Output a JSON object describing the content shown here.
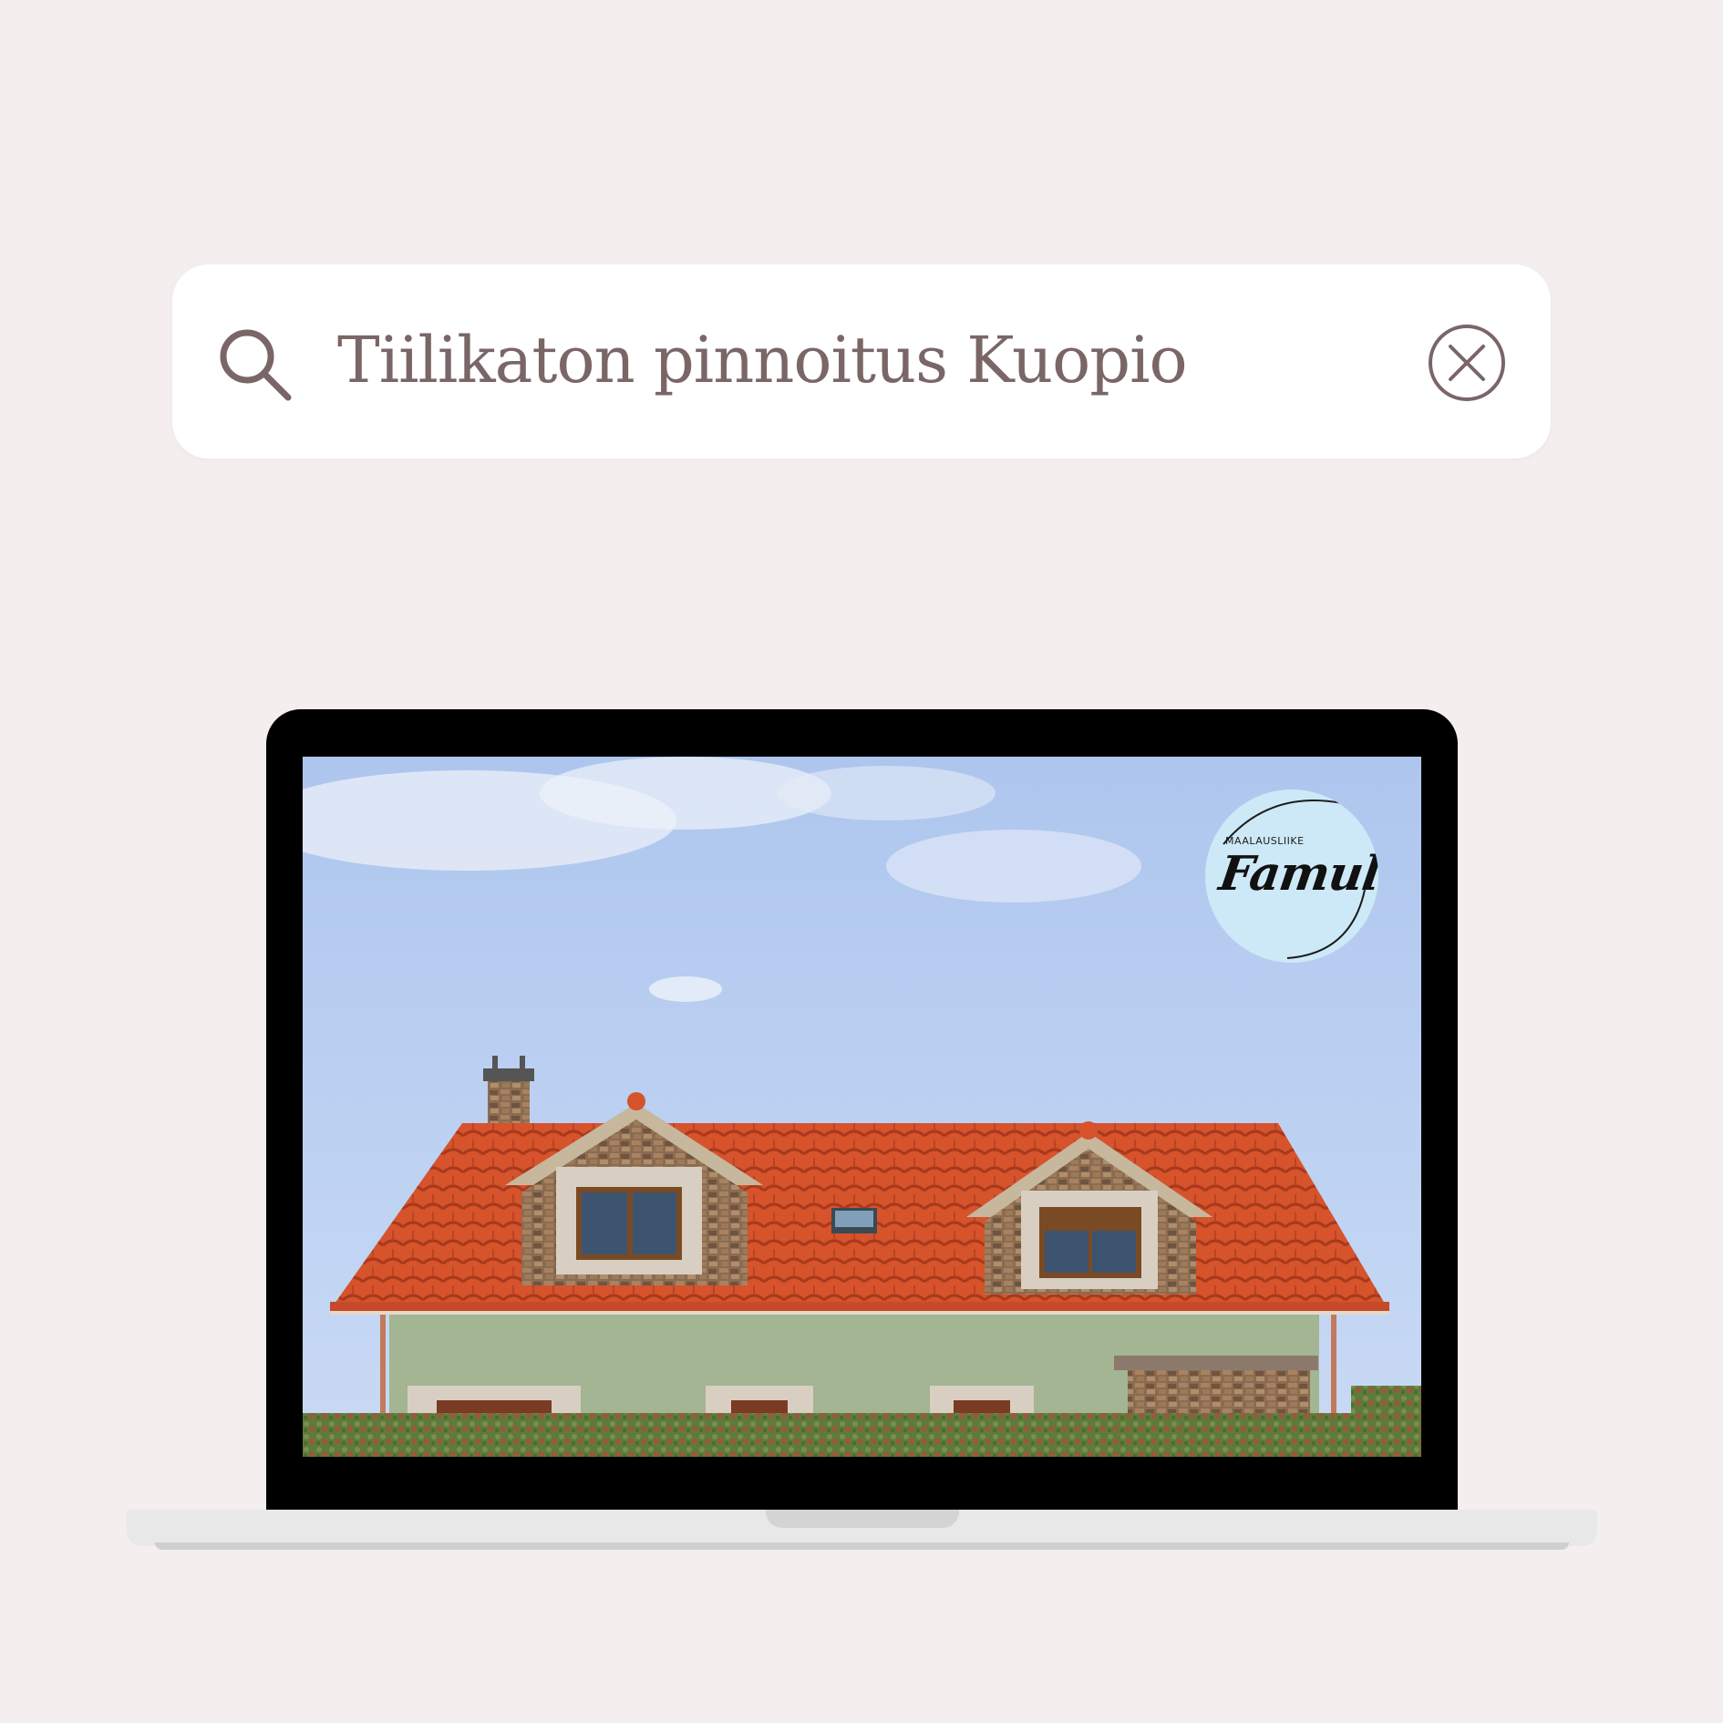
{
  "search": {
    "query": "Tiilikaton pinnoitus Kuopio",
    "icon": "search-icon",
    "clear_icon": "close-circle-icon"
  },
  "screen": {
    "photo": "house-with-red-tile-roof",
    "logo": {
      "small_text": "MAALAUSLIIKE",
      "script_text": "Famula"
    }
  },
  "colors": {
    "background": "#f5eeef",
    "search_text": "#7a6667",
    "roof": "#d9532d",
    "sky": "#b9cff2",
    "wall": "#a3b592",
    "badge": "#cde9f7"
  }
}
